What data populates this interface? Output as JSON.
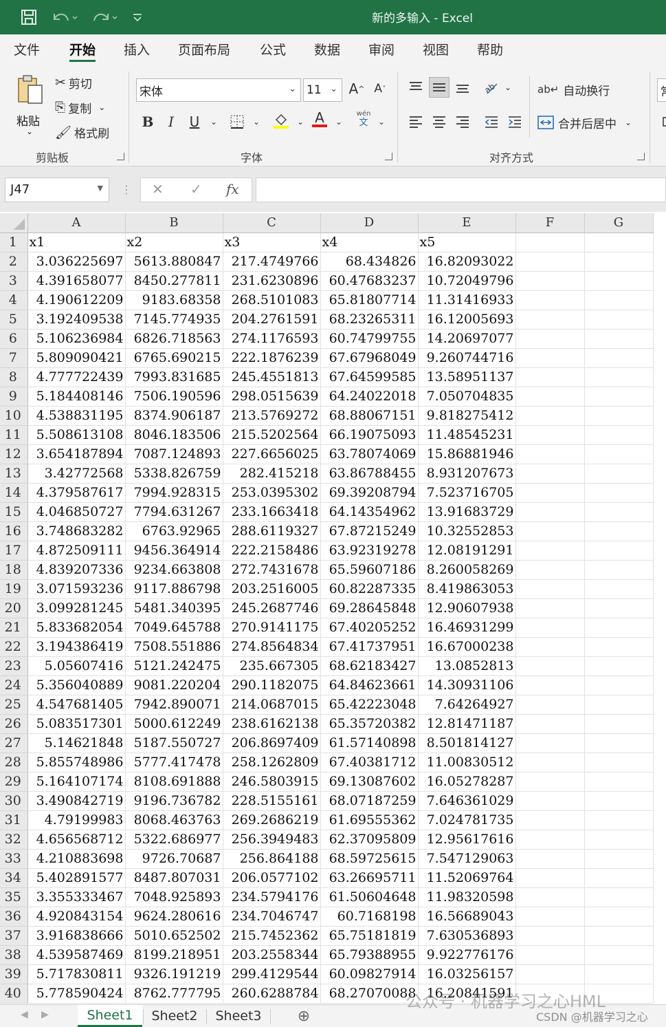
{
  "window": {
    "title": "新的多输入  -  Excel",
    "accent": "#217346"
  },
  "quick_access": {
    "save_icon": "save-icon",
    "undo_icon": "undo-icon",
    "redo_icon": "redo-icon",
    "customize_icon": "customize-icon"
  },
  "menu": {
    "tabs": [
      "文件",
      "开始",
      "插入",
      "页面布局",
      "公式",
      "数据",
      "审阅",
      "视图",
      "帮助"
    ],
    "active": "开始"
  },
  "ribbon": {
    "clipboard": {
      "paste": "粘贴",
      "cut": "剪切",
      "copy": "复制",
      "format_painter": "格式刷",
      "label": "剪贴板"
    },
    "font": {
      "font_name": "宋体",
      "font_size": "11",
      "grow": "A",
      "shrink": "A",
      "bold": "B",
      "italic": "I",
      "underline": "U",
      "font_color_letter": "A",
      "phonetic_top": "wén",
      "phonetic_bottom": "文",
      "label": "字体"
    },
    "alignment": {
      "wrap_text": "自动换行",
      "merge_center": "合并后居中",
      "label": "对齐方式"
    },
    "number_partial": "常"
  },
  "formula_bar": {
    "name_box": "J47",
    "cancel": "✕",
    "enter": "✓",
    "fx": "fx",
    "formula": ""
  },
  "grid": {
    "columns": [
      "A",
      "B",
      "C",
      "D",
      "E",
      "F",
      "G"
    ],
    "header_row": [
      "x1",
      "x2",
      "x3",
      "x4",
      "x5"
    ],
    "rows": [
      [
        "3.036225697",
        "5613.880847",
        "217.4749766",
        "68.434826",
        "16.82093022"
      ],
      [
        "4.391658077",
        "8450.277811",
        "231.6230896",
        "60.47683237",
        "10.72049796"
      ],
      [
        "4.190612209",
        "9183.68358",
        "268.5101083",
        "65.81807714",
        "11.31416933"
      ],
      [
        "3.192409538",
        "7145.774935",
        "204.2761591",
        "68.23265311",
        "16.12005693"
      ],
      [
        "5.106236984",
        "6826.718563",
        "274.1176593",
        "60.74799755",
        "14.20697077"
      ],
      [
        "5.809090421",
        "6765.690215",
        "222.1876239",
        "67.67968049",
        "9.260744716"
      ],
      [
        "4.777722439",
        "7993.831685",
        "245.4551813",
        "67.64599585",
        "13.58951137"
      ],
      [
        "5.184408146",
        "7506.190596",
        "298.0515639",
        "64.24022018",
        "7.050704835"
      ],
      [
        "4.538831195",
        "8374.906187",
        "213.5769272",
        "68.88067151",
        "9.818275412"
      ],
      [
        "5.508613108",
        "8046.183506",
        "215.5202564",
        "66.19075093",
        "11.48545231"
      ],
      [
        "3.654187894",
        "7087.124893",
        "227.6656025",
        "63.78074069",
        "15.86881946"
      ],
      [
        "3.42772568",
        "5338.826759",
        "282.415218",
        "63.86788455",
        "8.931207673"
      ],
      [
        "4.379587617",
        "7994.928315",
        "253.0395302",
        "69.39208794",
        "7.523716705"
      ],
      [
        "4.046850727",
        "7794.631267",
        "233.1663418",
        "64.14354962",
        "13.91683729"
      ],
      [
        "3.748683282",
        "6763.92965",
        "288.6119327",
        "67.87215249",
        "10.32552853"
      ],
      [
        "4.872509111",
        "9456.364914",
        "222.2158486",
        "63.92319278",
        "12.08191291"
      ],
      [
        "4.839207336",
        "9234.663808",
        "272.7431678",
        "65.59607186",
        "8.260058269"
      ],
      [
        "3.071593236",
        "9117.886798",
        "203.2516005",
        "60.82287335",
        "8.419863053"
      ],
      [
        "3.099281245",
        "5481.340395",
        "245.2687746",
        "69.28645848",
        "12.90607938"
      ],
      [
        "5.833682054",
        "7049.645788",
        "270.9141175",
        "67.40205252",
        "16.46931299"
      ],
      [
        "3.194386419",
        "7508.551886",
        "274.8564834",
        "67.41737951",
        "16.67000238"
      ],
      [
        "5.05607416",
        "5121.242475",
        "235.667305",
        "68.62183427",
        "13.0852813"
      ],
      [
        "5.356040889",
        "9081.220204",
        "290.1182075",
        "64.84623661",
        "14.30931106"
      ],
      [
        "4.547681405",
        "7942.890071",
        "214.0687015",
        "65.42223048",
        "7.64264927"
      ],
      [
        "5.083517301",
        "5000.612249",
        "238.6162138",
        "65.35720382",
        "12.81471187"
      ],
      [
        "5.14621848",
        "5187.550727",
        "206.8697409",
        "61.57140898",
        "8.501814127"
      ],
      [
        "5.855748986",
        "5777.417478",
        "258.1262809",
        "67.40381712",
        "11.00830512"
      ],
      [
        "5.164107174",
        "8108.691888",
        "246.5803915",
        "69.13087602",
        "16.05278287"
      ],
      [
        "3.490842719",
        "9196.736782",
        "228.5155161",
        "68.07187259",
        "7.646361029"
      ],
      [
        "4.79199983",
        "8068.463763",
        "269.2686219",
        "61.69555362",
        "7.024781735"
      ],
      [
        "4.656568712",
        "5322.686977",
        "256.3949483",
        "62.37095809",
        "12.95617616"
      ],
      [
        "4.210883698",
        "9726.70687",
        "256.864188",
        "68.59725615",
        "7.547129063"
      ],
      [
        "5.402891577",
        "8487.807031",
        "206.0577102",
        "63.26695711",
        "11.52069764"
      ],
      [
        "3.355333467",
        "7048.925893",
        "234.5794176",
        "61.50604648",
        "11.98320598"
      ],
      [
        "4.920843154",
        "9624.280616",
        "234.7046747",
        "60.7168198",
        "16.56689043"
      ],
      [
        "3.916838666",
        "5010.652502",
        "215.7452362",
        "65.75181819",
        "7.630536893"
      ],
      [
        "4.539587469",
        "8199.218951",
        "203.2558344",
        "65.79388955",
        "9.922776176"
      ],
      [
        "5.717830811",
        "9326.191219",
        "299.4129544",
        "60.09827914",
        "16.03256157"
      ],
      [
        "5.778590424",
        "8762.777795",
        "260.6288784",
        "68.27070088",
        "16.20841591"
      ]
    ]
  },
  "sheets": {
    "tabs": [
      "Sheet1",
      "Sheet2",
      "Sheet3"
    ],
    "active": "Sheet1",
    "add": "⊕"
  },
  "watermark": {
    "line1": "公众号 · 机器学习之心HML",
    "line2": "CSDN @机器学习之心"
  }
}
